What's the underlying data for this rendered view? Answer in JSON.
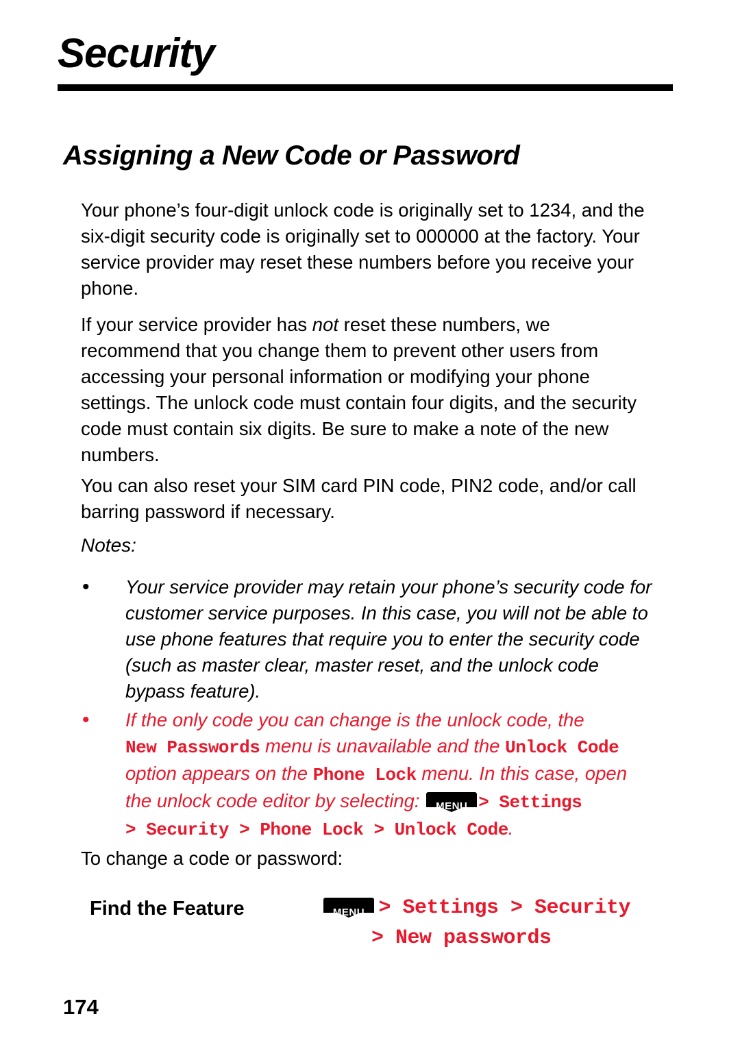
{
  "header": {
    "chapter_title": "Security"
  },
  "section": {
    "title": "Assigning a New Code or Password"
  },
  "paragraphs": {
    "p1": "Your phone’s four-digit unlock code is originally set to 1234, and the six-digit security code is originally set to 000000 at the factory. Your service provider may reset these numbers before you receive your phone.",
    "p2_part1": "If your service provider has ",
    "p2_italic": "not",
    "p2_part2": " reset these numbers, we recommend that you change them to prevent other users from accessing your personal information or modifying your phone settings. The unlock code must contain four digits, and the security code must contain six digits. Be sure to make a note of the new numbers.",
    "p3": "You can also reset your SIM card PIN code, PIN2 code, and/or call barring password if necessary."
  },
  "notes": {
    "label": "Notes:",
    "bullet_glyph": "•",
    "note1": "Your service provider may retain your phone’s security code for customer service purposes. In this case, you will not be able to use phone features that require you to enter the security code (such as master clear, master reset, and the unlock code bypass feature).",
    "note2": {
      "seg1": "If the only code you can change is the unlock code, the",
      "mono1": "New Passwords",
      "seg2": " menu is unavailable and the ",
      "mono2": "Unlock Code",
      "seg3": "option appears on the ",
      "mono3": "Phone Lock",
      "seg4": " menu. In this case, open",
      "seg5": "the unlock code editor by selecting: ",
      "menu_key_label": "MENU",
      "mono4": "> Settings",
      "mono5": "> Security > Phone Lock > Unlock Code",
      "period": "."
    }
  },
  "to_change": "To change a code or password:",
  "find_feature": {
    "label": "Find the Feature",
    "menu_key_label": "MENU",
    "path_line1": "> Settings > Security",
    "path_line2": "> New passwords"
  },
  "footer": {
    "page_number": "174"
  },
  "colors": {
    "red": "#e8192c",
    "black": "#000000"
  }
}
